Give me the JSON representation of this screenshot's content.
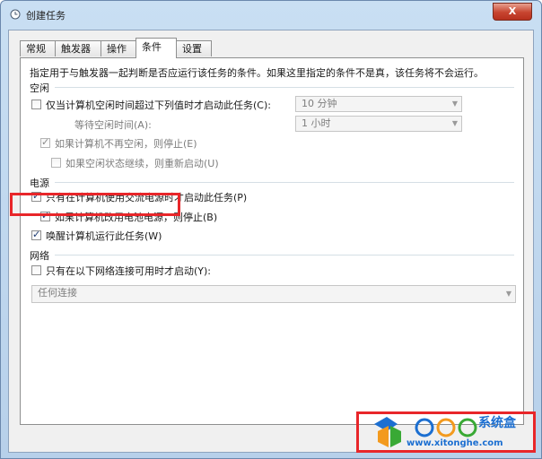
{
  "window": {
    "title": "创建任务",
    "close_label": "X"
  },
  "tabs": [
    {
      "label": "常规"
    },
    {
      "label": "触发器"
    },
    {
      "label": "操作"
    },
    {
      "label": "条件",
      "active": true
    },
    {
      "label": "设置"
    }
  ],
  "panel": {
    "description": "指定用于与触发器一起判断是否应运行该任务的条件。如果这里指定的条件不是真，该任务将不会运行。",
    "idle": {
      "header": "空闲",
      "start_if_idle": {
        "label": "仅当计算机空闲时间超过下列值时才启动此任务(C):",
        "checked": false
      },
      "idle_duration": {
        "value": "10 分钟"
      },
      "wait_label": "等待空闲时间(A):",
      "wait_value": {
        "value": "1 小时"
      },
      "stop_if_not_idle": {
        "label": "如果计算机不再空闲，则停止(E)",
        "checked": true
      },
      "restart_if_idle_resumes": {
        "label": "如果空闲状态继续，则重新启动(U)",
        "checked": false
      }
    },
    "power": {
      "header": "电源",
      "ac_only": {
        "label": "只有在计算机使用交流电源时才启动此任务(P)",
        "checked": true
      },
      "stop_on_battery": {
        "label": "如果计算机改用电池电源，则停止(B)",
        "checked": true
      },
      "wake_to_run": {
        "label": "唤醒计算机运行此任务(W)",
        "checked": true
      }
    },
    "network": {
      "header": "网络",
      "start_if_network": {
        "label": "只有在以下网络连接可用时才启动(Y):",
        "checked": false
      },
      "connection": {
        "value": "任何连接"
      }
    }
  },
  "watermark": {
    "brand": "系统盒",
    "url": "www.xitonghe.com",
    "colors": {
      "orange": "#f39a1e",
      "blue": "#1c6fd1",
      "green": "#39a935"
    }
  }
}
